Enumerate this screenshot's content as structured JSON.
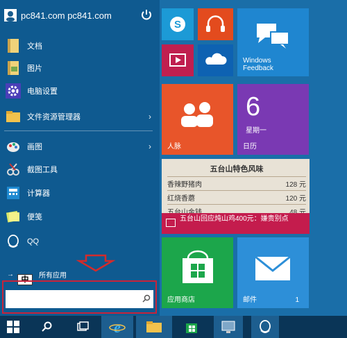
{
  "user": {
    "name": "pc841.com pc841.com"
  },
  "menu": [
    {
      "label": "文档",
      "icon": "documents-icon"
    },
    {
      "label": "图片",
      "icon": "pictures-icon"
    },
    {
      "label": "电脑设置",
      "icon": "settings-gear-icon"
    },
    {
      "label": "文件资源管理器",
      "icon": "file-explorer-icon"
    },
    {
      "label": "画图",
      "icon": "paint-icon"
    },
    {
      "label": "截图工具",
      "icon": "snipping-tool-icon"
    },
    {
      "label": "计算器",
      "icon": "calculator-icon"
    },
    {
      "label": "便笺",
      "icon": "sticky-notes-icon"
    },
    {
      "label": "QQ",
      "icon": "qq-icon"
    }
  ],
  "all_apps": "所有应用",
  "ime_indicator": "中",
  "tiles": {
    "windows_feedback": "Windows\nFeedback",
    "people": "人脉",
    "calendar_day": "6",
    "calendar_weekday": "星期一",
    "calendar": "日历",
    "store": "应用商店",
    "mail": "邮件",
    "mail_count": "1"
  },
  "food": {
    "title": "五台山特色风味",
    "rows": [
      {
        "name": "香辣野猪肉",
        "price": "128 元"
      },
      {
        "name": "红烧香蘑",
        "price": "120 元"
      },
      {
        "name": "五台山金钱",
        "price": "48 元"
      }
    ],
    "caption": "五台山回应炖山鸡400元：嫌贵别点"
  },
  "colors": {
    "skype": "#1c9ad6",
    "music": "#e34b1e",
    "video": "#c01f4f",
    "onedrive": "#0e62b2",
    "feedback": "#1f86d0",
    "people": "#e8552a",
    "calendar": "#7a39b3",
    "store": "#1ca64b",
    "mail": "#2d8fd8"
  }
}
